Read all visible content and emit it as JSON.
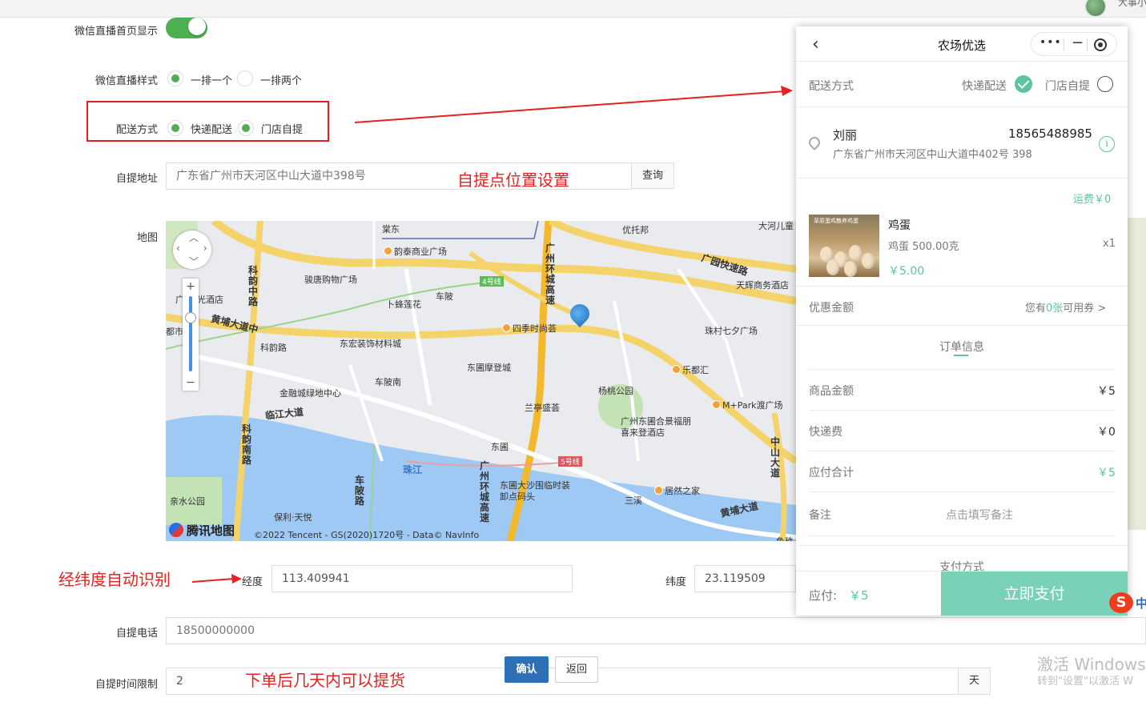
{
  "topbar": {
    "user_fragment": "大事小"
  },
  "form": {
    "wechat_live_home": {
      "label": "微信直播首页显示",
      "enabled": true
    },
    "wechat_live_style": {
      "label": "微信直播样式",
      "options": [
        {
          "label": "一排一个",
          "selected": true
        },
        {
          "label": "一排两个",
          "selected": false
        }
      ]
    },
    "delivery": {
      "label": "配送方式",
      "options": [
        {
          "label": "快递配送",
          "selected": true
        },
        {
          "label": "门店自提",
          "selected": true
        }
      ]
    },
    "pickup_address": {
      "label": "自提地址",
      "placeholder": "广东省广州市天河区中山大道中398号",
      "query_button": "查询"
    },
    "map_label": "地图",
    "longitude": {
      "label": "经度",
      "value": "113.409941"
    },
    "latitude": {
      "label": "纬度",
      "value": "23.119509"
    },
    "pickup_phone": {
      "label": "自提电话",
      "placeholder": "18500000000"
    },
    "pickup_time_limit": {
      "label": "自提时间限制",
      "value": "2",
      "suffix": "天"
    },
    "confirm_button": "确认",
    "back_button": "返回"
  },
  "annotations": {
    "pickup_point": "自提点位置设置",
    "lnglat_auto": "经纬度自动识别",
    "pickup_days": "下单后几天内可以提货"
  },
  "map": {
    "labels": {
      "l1": "棠东",
      "l2": "优托邦",
      "l3": "大河儿童",
      "l4": "韵泰商业广场",
      "l5": "骏唐购物广场",
      "l6": "车陂",
      "l7": "卜蜂莲花",
      "l8": "广州环城高速",
      "l9": "广园快速路",
      "l10": "天辉商务酒店",
      "l11": "阳光酒店",
      "l12": "黄埔大道中",
      "l13": "科韵路",
      "l14": "科韵中路",
      "l15": "四季时尚荟",
      "l16": "珠村七夕广场",
      "l17": "东宏装饰材料城",
      "l18": "东圃摩登城",
      "l19": "车陂南",
      "l20": "乐都汇",
      "l21": "杨桃公园",
      "l22": "金融城绿地中心",
      "l23": "兰亭盛荟",
      "l24": "M+Park渡广场",
      "l25": "临江大道",
      "l26": "广州东圃合景福朋喜来登酒店",
      "l27": "东圃",
      "l28": "科韵南路",
      "l29": "珠江",
      "l30": "中山大道",
      "l31": "东圃大沙围临时装卸点码头",
      "l32": "居然之家",
      "l33": "三溪",
      "l34": "黄埔大道",
      "l35": "亲水公园",
      "l36": "保利·天悦",
      "l37": "车陂路",
      "l38": "4号线",
      "l39": "5号线",
      "l40": "广州环城高速",
      "l41": "都市",
      "l42": "广",
      "l43": "鱼珠"
    },
    "logo": "腾讯地图",
    "copyright": "©2022 Tencent - GS(2020)1720号 - Data© NavInfo"
  },
  "phone": {
    "title": "农场优选",
    "delivery": {
      "label": "配送方式",
      "express": "快递配送",
      "pickup": "门店自提",
      "express_selected": true,
      "pickup_selected": false
    },
    "address": {
      "name": "刘丽",
      "phone": "18565488985",
      "detail": "广东省广州市天河区中山大道中402号 398"
    },
    "shipping_fee": "运费￥0",
    "product": {
      "name": "鸡蛋",
      "spec": "鸡蛋 500.00克",
      "qty": "x1",
      "price": "￥5.00",
      "image_caption": "草原蛋鸡散养鸡蛋"
    },
    "coupon": {
      "label": "优惠金额",
      "prefix": "您有",
      "count": "0张",
      "suffix": "可用券 >"
    },
    "order_info": "订单信息",
    "goods_amount": {
      "label": "商品金额",
      "value": "￥5"
    },
    "express_fee": {
      "label": "快递费",
      "value": "￥0"
    },
    "total": {
      "label": "应付合计",
      "value": "￥5"
    },
    "remark": {
      "label": "备注",
      "placeholder": "点击填写备注"
    },
    "pay_method": "支付方式",
    "pay_bar": {
      "label": "应付:",
      "amount": "￥5",
      "button": "立即支付"
    }
  },
  "system": {
    "watermark_title": "激活 Windows",
    "watermark_sub": "转到\"设置\"以激活 W",
    "ime": "S",
    "ime_tail": "中"
  },
  "colors": {
    "green": "#4cb050",
    "accent": "#5ec3a1",
    "annotation_red": "#e52121",
    "confirm_blue": "#2d70b5"
  }
}
